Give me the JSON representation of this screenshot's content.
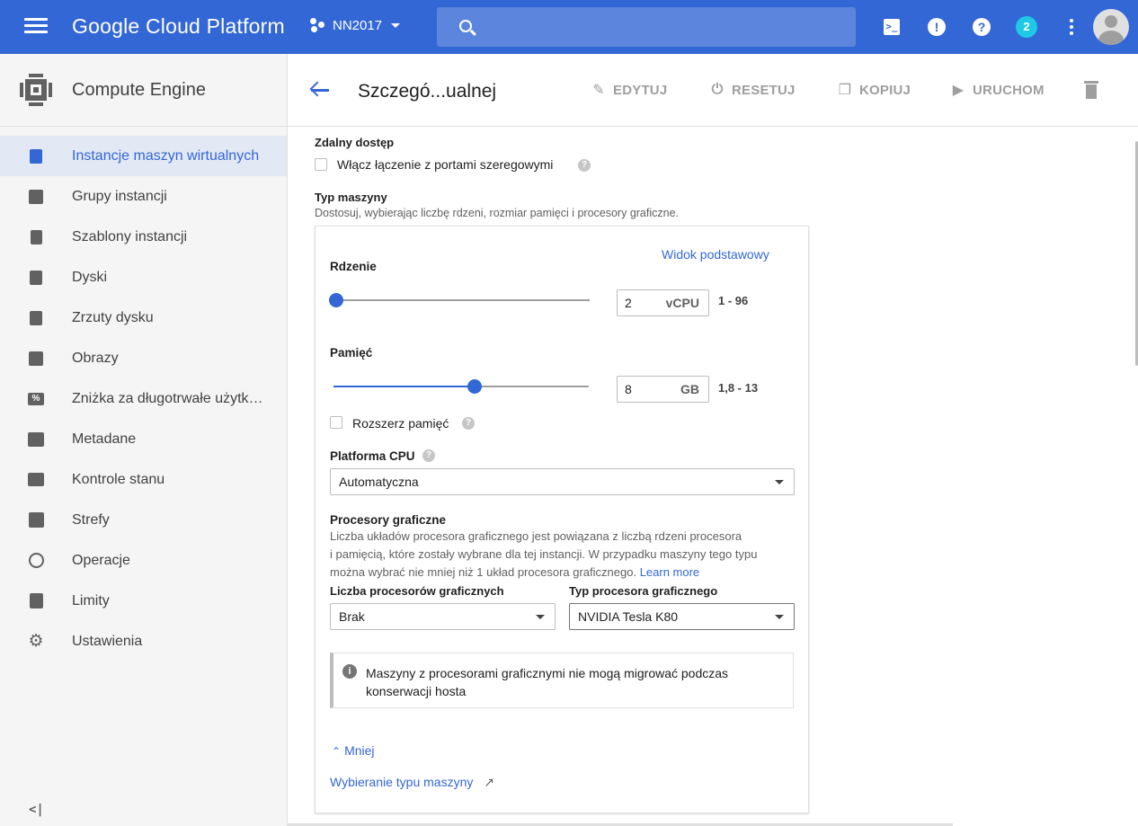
{
  "topbar": {
    "brand": "Google Cloud Platform",
    "project": "NN2017",
    "notifications_count": "2",
    "icons": [
      "menu-icon",
      "terminal-icon",
      "alert-icon",
      "help-icon",
      "more-vert-icon",
      "account-icon"
    ],
    "accent_color": "#3367d6"
  },
  "sidebar": {
    "title": "Compute Engine",
    "items": [
      {
        "label": "Instancje maszyn wirtualnych",
        "icon": "vm-instances-icon",
        "active": true
      },
      {
        "label": "Grupy instancji",
        "icon": "instance-groups-icon"
      },
      {
        "label": "Szablony instancji",
        "icon": "instance-templates-icon"
      },
      {
        "label": "Dyski",
        "icon": "disks-icon"
      },
      {
        "label": "Zrzuty dysku",
        "icon": "snapshots-icon"
      },
      {
        "label": "Obrazy",
        "icon": "images-icon"
      },
      {
        "label": "Zniżka za długotrwałe użytkowanie",
        "icon": "percent-icon"
      },
      {
        "label": "Metadane",
        "icon": "metadata-icon"
      },
      {
        "label": "Kontrole stanu",
        "icon": "health-checks-icon"
      },
      {
        "label": "Strefy",
        "icon": "zones-icon"
      },
      {
        "label": "Operacje",
        "icon": "clock-icon"
      },
      {
        "label": "Limity",
        "icon": "quotas-icon"
      },
      {
        "label": "Ustawienia",
        "icon": "gear-icon"
      }
    ],
    "collapse_label": "<|"
  },
  "header": {
    "title": "Szczegó...ualnej",
    "actions": {
      "edit": "EDYTUJ",
      "reset": "RESETUJ",
      "copy": "KOPIUJ",
      "start": "URUCHOM"
    }
  },
  "form": {
    "remote_access": {
      "heading": "Zdalny dostęp",
      "checkbox_label": "Włącz łączenie z portami szeregowymi"
    },
    "machine_type": {
      "heading": "Typ maszyny",
      "description": "Dostosuj, wybierając liczbę rdzeni, rozmiar pamięci i procesory graficzne.",
      "basic_view_link": "Widok podstawowy",
      "cores": {
        "label": "Rdzenie",
        "value": "2",
        "unit": "vCPU",
        "range": "1 - 96",
        "min": 1,
        "max": 96,
        "current": 2
      },
      "memory": {
        "label": "Pamięć",
        "value": "8",
        "unit": "GB",
        "range": "1,8 - 13",
        "min": 1.8,
        "max": 13,
        "current": 8
      },
      "extend_memory_label": "Rozszerz pamięć",
      "cpu_platform": {
        "label": "Platforma CPU",
        "value": "Automatyczna"
      },
      "gpu": {
        "heading": "Procesory graficzne",
        "description_line1": "Liczba układów procesora graficznego jest powiązana z liczbą rdzeni procesora",
        "description_line2": "i pamięcią, które zostały wybrane dla tej instancji. W przypadku maszyny tego typu",
        "description_line3": "można wybrać nie mniej niż 1 układ procesora graficznego.",
        "learn_more": "Learn more",
        "count_label": "Liczba procesorów graficznych",
        "count_value": "Brak",
        "type_label": "Typ procesora graficznego",
        "type_value": "NVIDIA Tesla K80"
      },
      "info_message": "Maszyny z procesorami graficznymi nie mogą migrować podczas konserwacji hosta",
      "less_link": "Mniej",
      "choose_link": "Wybieranie typu maszyny"
    }
  }
}
